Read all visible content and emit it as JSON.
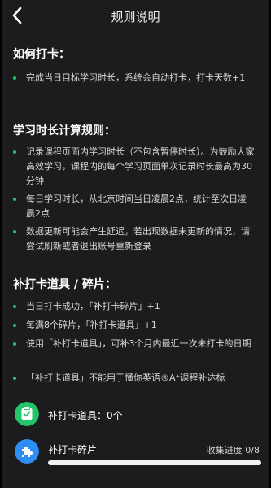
{
  "header": {
    "title": "规则说明"
  },
  "sections": [
    {
      "title": "如何打卡：",
      "items": [
        "完成当日目标学习时长，系统会自动打卡，打卡天数+1"
      ]
    },
    {
      "title": "学习时长计算规则：",
      "items": [
        "记录课程页面内学习时长（不包含暂停时长）。为鼓励大家高效学习，课程内的每个学习页面单次记录时长最高为30分钟",
        "每日学习时长，从北京时间当日凌晨2点，统计至次日凌晨2点",
        "数据更新可能会产生延迟，若出现数据未更新的情况，请尝试刷新或者退出账号重新登录"
      ]
    },
    {
      "title": "补打卡道具 / 碎片：",
      "items": [
        "当日打卡成功，「补打卡碎片」+1",
        "每满8个碎片，「补打卡道具」+1",
        "使用「补打卡道具」，可补3个月内最近一次未打卡的日期",
        "「补打卡道具」不能用于懂你英语®A⁺课程补达标"
      ]
    }
  ],
  "props_card": {
    "label": "补打卡道具：0个"
  },
  "fragments_card": {
    "label": "补打卡碎片",
    "progress_label": "收集进度 0/8",
    "progress_value": 0
  },
  "colors": {
    "accent_green": "#23c46a",
    "accent_blue": "#2e8ef5",
    "background": "#1c1c1e"
  },
  "icons": {
    "back": "chevron-left-icon",
    "props": "check-badge-icon",
    "fragments": "puzzle-piece-icon"
  }
}
